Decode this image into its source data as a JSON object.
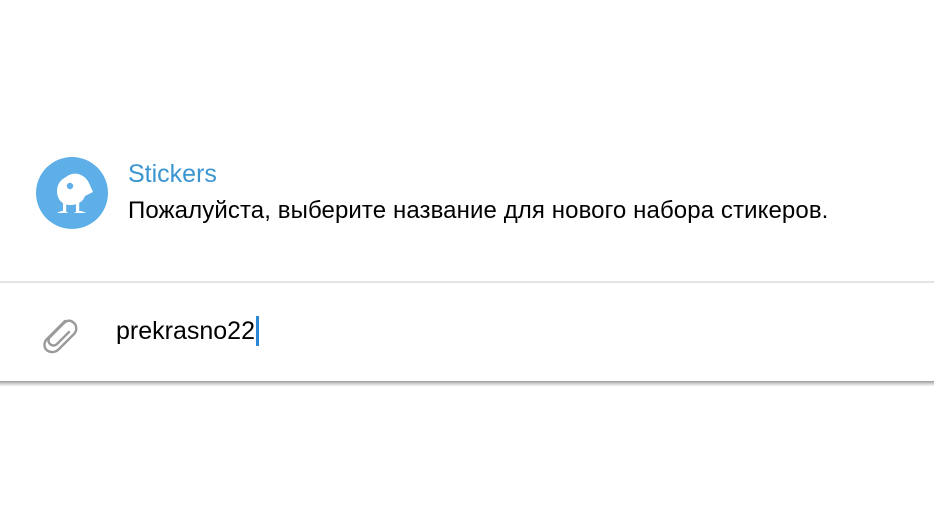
{
  "message": {
    "sender": "Stickers",
    "text": "Пожалуйста, выберите название для нового набора стикеров.",
    "avatar_icon": "stickers-bot-icon",
    "avatar_color": "#5eaee8",
    "sender_color": "#3a95d1"
  },
  "composer": {
    "attach_icon": "paperclip-icon",
    "value": "prekrasno22",
    "caret_color": "#2b86d6"
  }
}
